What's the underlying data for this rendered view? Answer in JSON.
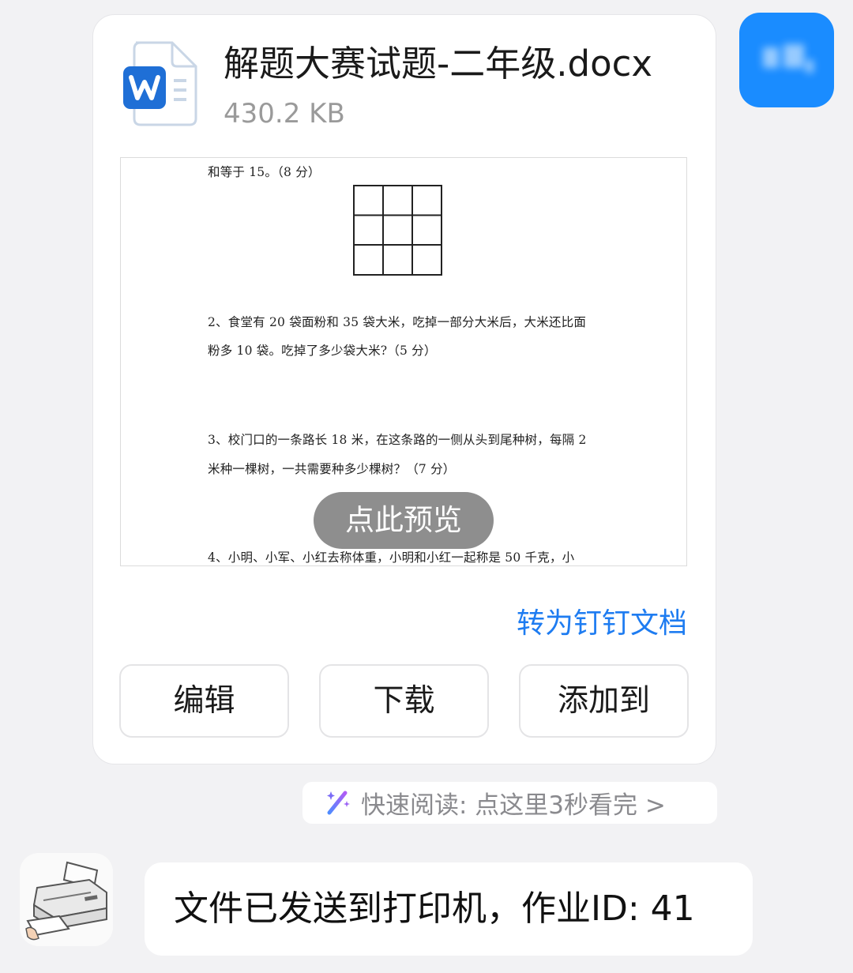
{
  "file": {
    "name": "解题大赛试题-二年级.docx",
    "size": "430.2 KB",
    "icon": "word-document-icon"
  },
  "preview": {
    "lines": [
      "和等于 15。（8 分）",
      "2、食堂有 20 袋面粉和 35 袋大米，吃掉一部分大米后，大米还比面",
      "粉多 10 袋。吃掉了多少袋大米?（5 分）",
      "3、校门口的一条路长 18 米，在这条路的一侧从头到尾种树，每隔 2",
      "米种一棵树，一共需要种多少棵树？（7 分）",
      "4、小明、小军、小红去称体重，小明和小红一起称是 50 千克，小"
    ],
    "button": "点此预览"
  },
  "convert_link": "转为钉钉文档",
  "actions": {
    "edit": "编辑",
    "download": "下载",
    "add_to": "添加到"
  },
  "quick_read": {
    "text": "快速阅读: 点这里3秒看完 >",
    "icon": "magic-wand-icon"
  },
  "reply": {
    "text": "文件已发送到打印机，作业ID: 41"
  },
  "colors": {
    "accent": "#1e7cf1",
    "avatar": "#1a8cff",
    "word": "#1f6fd6"
  }
}
